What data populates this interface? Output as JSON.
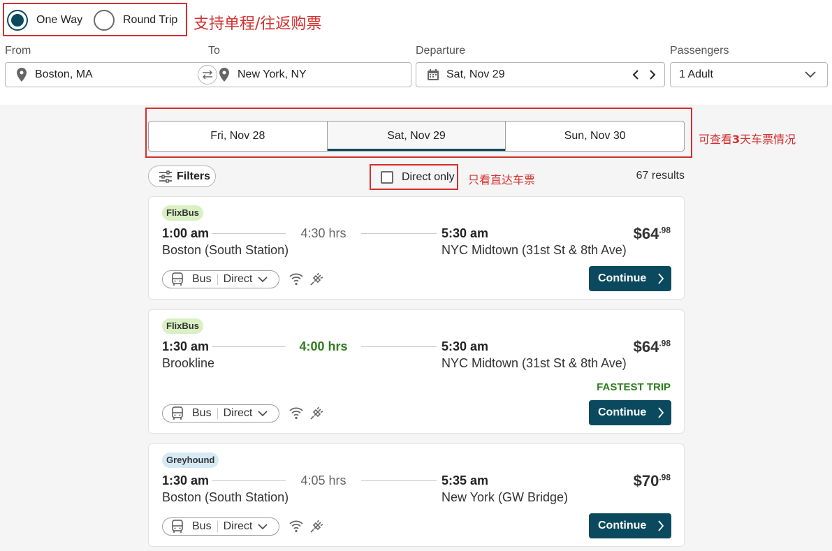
{
  "trip_type": {
    "options": [
      {
        "label": "One Way",
        "selected": true
      },
      {
        "label": "Round Trip",
        "selected": false
      }
    ],
    "annotation": "支持单程/往返购票"
  },
  "search": {
    "from_label": "From",
    "from_value": "Boston, MA",
    "to_label": "To",
    "to_value": "New York, NY",
    "departure_label": "Departure",
    "departure_value": "Sat, Nov 29",
    "passengers_label": "Passengers",
    "passengers_value": "1 Adult"
  },
  "date_tabs": {
    "items": [
      {
        "label": "Fri, Nov 28",
        "active": false
      },
      {
        "label": "Sat, Nov 29",
        "active": true
      },
      {
        "label": "Sun, Nov 30",
        "active": false
      }
    ],
    "annotation_pre": "可查看",
    "annotation_num": "3",
    "annotation_post": "天车票情况"
  },
  "toolbar": {
    "filters_label": "Filters",
    "direct_only_label": "Direct only",
    "direct_only_checked": false,
    "direct_annotation": "只看直达车票",
    "results_count": "67 results"
  },
  "trips": [
    {
      "carrier": "FlixBus",
      "carrier_color": "#d9f0c2",
      "dep_time": "1:00 am",
      "dep_location": "Boston (South Station)",
      "duration": "4:30 hrs",
      "fastest": false,
      "arr_time": "5:30 am",
      "arr_location": "NYC Midtown (31st St & 8th Ave)",
      "price_main": "$64",
      "price_cents": ".98",
      "fastest_label": "",
      "mode": "Bus",
      "route_type": "Direct",
      "continue_label": "Continue",
      "amenities": [
        "wifi-icon",
        "power-outlet-icon"
      ]
    },
    {
      "carrier": "FlixBus",
      "carrier_color": "#d9f0c2",
      "dep_time": "1:30 am",
      "dep_location": "Brookline",
      "duration": "4:00 hrs",
      "fastest": true,
      "arr_time": "5:30 am",
      "arr_location": "NYC Midtown (31st St & 8th Ave)",
      "price_main": "$64",
      "price_cents": ".98",
      "fastest_label": "FASTEST TRIP",
      "mode": "Bus",
      "route_type": "Direct",
      "continue_label": "Continue",
      "amenities": [
        "wifi-icon",
        "power-outlet-icon"
      ]
    },
    {
      "carrier": "Greyhound",
      "carrier_color": "#d6eaf5",
      "dep_time": "1:30 am",
      "dep_location": "Boston (South Station)",
      "duration": "4:05 hrs",
      "fastest": false,
      "arr_time": "5:35 am",
      "arr_location": "New York (GW Bridge)",
      "price_main": "$70",
      "price_cents": ".98",
      "fastest_label": "",
      "mode": "Bus",
      "route_type": "Direct",
      "continue_label": "Continue",
      "amenities": [
        "wifi-icon",
        "power-outlet-icon"
      ]
    }
  ],
  "colors": {
    "primary": "#0b4a5e",
    "annotation_red": "#d32f2f",
    "fastest_green": "#2e7d1e"
  }
}
